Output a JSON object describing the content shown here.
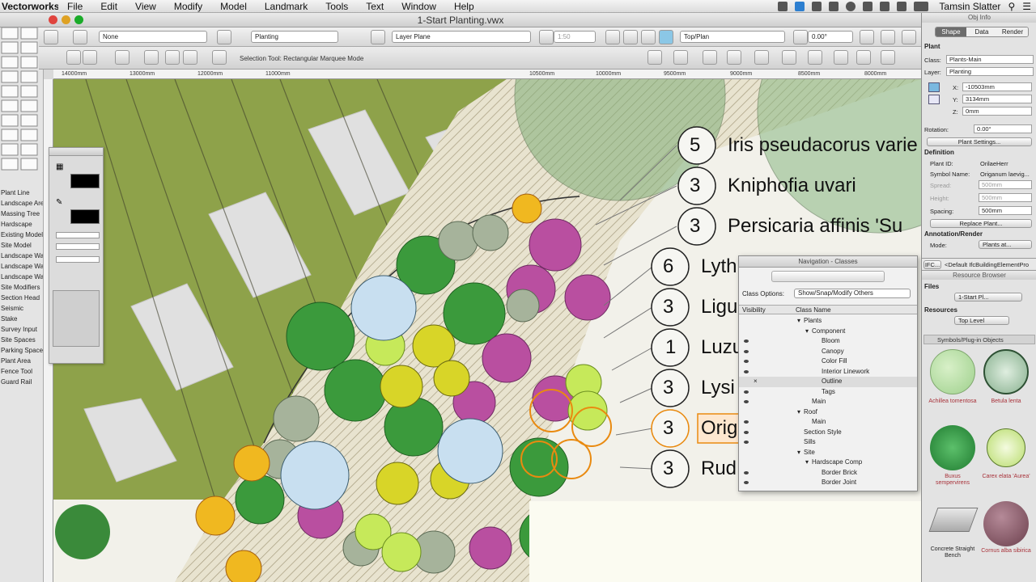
{
  "menubar": {
    "app": "Vectorworks",
    "items": [
      "File",
      "Edit",
      "View",
      "Modify",
      "Model",
      "Landmark",
      "Tools",
      "Text",
      "Window",
      "Help"
    ],
    "user": "Tamsin Slatter"
  },
  "window": {
    "title": "1-Start Planting.vwx"
  },
  "toolbar": {
    "class_select": "None",
    "layer_select": "Planting",
    "layer_plane": "Layer Plane",
    "scale": "1:50",
    "view": "Top/Plan",
    "rotation": "0.00°",
    "mode_hint": "Selection Tool: Rectangular Marquee Mode"
  },
  "ruler": {
    "ticks": [
      "14000mm",
      "13000mm",
      "12000mm",
      "11000mm",
      "10500mm",
      "10000mm",
      "9500mm",
      "9000mm",
      "8500mm",
      "8000mm"
    ]
  },
  "left_tools": {
    "labels": [
      "Plant Line",
      "Landscape Area",
      "Massing Tree",
      "Hardscape",
      "Existing Model",
      "Site Model",
      "Landscape Wall",
      "Landscape Wall",
      "Landscape Wall",
      "Site Modifiers",
      "Section Head",
      "Seismic",
      "Stake",
      "Survey Input",
      "Site Spaces",
      "Parking Spaces",
      "Plant Area",
      "Fence Tool",
      "Guard Rail"
    ]
  },
  "plan": {
    "tags": [
      {
        "qty": "5",
        "name": "Iris pseudacorus varie"
      },
      {
        "qty": "3",
        "name": "Kniphofia uvari"
      },
      {
        "qty": "3",
        "name": "Persicaria affinis 'Su"
      },
      {
        "qty": "6",
        "name": "Lyth"
      },
      {
        "qty": "3",
        "name": "Ligu"
      },
      {
        "qty": "1",
        "name": "Luzu"
      },
      {
        "qty": "3",
        "name": "Lysi"
      },
      {
        "qty": "3",
        "name": "Orig"
      },
      {
        "qty": "3",
        "name": "Rud"
      }
    ]
  },
  "navigation": {
    "title": "Navigation - Classes",
    "class_options_label": "Class Options:",
    "class_options_value": "Show/Snap/Modify Others",
    "col_visibility": "Visibility",
    "col_class_name": "Class Name",
    "rows": [
      "Plants",
      "Component",
      "Bloom",
      "Canopy",
      "Color Fill",
      "Interior Linework",
      "Outline",
      "Tags",
      "Main",
      "Roof",
      "Main",
      "Section Style",
      "Sills",
      "Site",
      "Hardscape Comp",
      "Border Brick",
      "Border Joint"
    ]
  },
  "obj_info": {
    "title": "Obj Info",
    "tabs": [
      "Shape",
      "Data",
      "Render"
    ],
    "object_type": "Plant",
    "class_label": "Class:",
    "class_value": "Plants-Main",
    "layer_label": "Layer:",
    "layer_value": "Planting",
    "x_label": "X:",
    "x_value": "-10503mm",
    "y_label": "Y:",
    "y_value": "3134mm",
    "z_label": "Z:",
    "z_value": "0mm",
    "rotation_label": "Rotation:",
    "rotation_value": "0.00°",
    "plant_settings_button": "Plant Settings...",
    "definition_label": "Definition",
    "plant_id_label": "Plant ID:",
    "plant_id_value": "OrilaeHerr",
    "symbol_name_label": "Symbol Name:",
    "symbol_name_value": "Origanum laevig...",
    "spread_label": "Spread:",
    "spread_value": "500mm",
    "height_label": "Height:",
    "height_value": "500mm",
    "spacing_label": "Spacing:",
    "spacing_value": "500mm",
    "replace_plant_button": "Replace Plant...",
    "annotation_label": "Annotation/Render",
    "mode_label": "Mode:",
    "mode_value": "Plants at...",
    "ifc_label": "IFC...",
    "ifc_value": "<Default IfcBuildingElementPro"
  },
  "resource_browser": {
    "title": "Resource Browser",
    "files_label": "Files",
    "file_value": "1-Start Pl...",
    "resources_label": "Resources",
    "level_value": "Top Level",
    "category": "Symbols/Plug-in Objects",
    "items": [
      {
        "name": "Achillea tomentosa",
        "color": "#b7e3a6"
      },
      {
        "name": "Betula lenta",
        "color": "#9fc6a8"
      },
      {
        "name": "Buxus sempervirens",
        "color": "#2f9b42"
      },
      {
        "name": "Carex elata 'Aurea'",
        "color": "#d6ee9c"
      },
      {
        "name": "Concrete Straight Bench",
        "color": "#c9c9c9"
      },
      {
        "name": "Cornus alba sibirica",
        "color": "#7a4f5a"
      }
    ]
  }
}
